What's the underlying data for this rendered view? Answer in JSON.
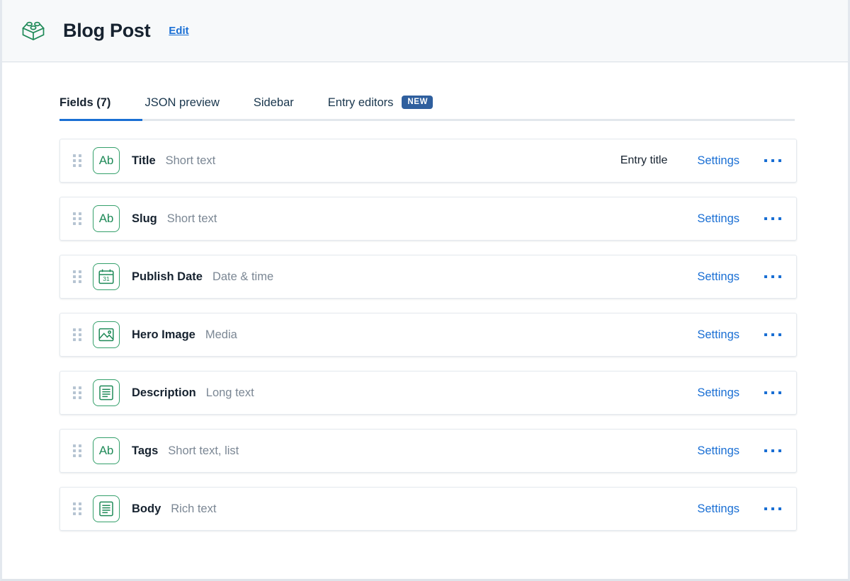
{
  "header": {
    "icon": "lego-brick-icon",
    "title": "Blog Post",
    "edit_label": "Edit",
    "accent_green": "#1f8a58",
    "link_blue": "#1a6fd4"
  },
  "tabs": [
    {
      "label": "Fields (7)",
      "active": true,
      "badge": null
    },
    {
      "label": "JSON preview",
      "active": false,
      "badge": null
    },
    {
      "label": "Sidebar",
      "active": false,
      "badge": null
    },
    {
      "label": "Entry editors",
      "active": false,
      "badge": "NEW"
    }
  ],
  "fields": {
    "settings_label": "Settings",
    "more_label": "...",
    "items": [
      {
        "icon": "short-text-icon",
        "icon_glyph": "Ab",
        "name": "Title",
        "type": "Short text",
        "tag": "Entry title"
      },
      {
        "icon": "short-text-icon",
        "icon_glyph": "Ab",
        "name": "Slug",
        "type": "Short text",
        "tag": ""
      },
      {
        "icon": "calendar-icon",
        "icon_glyph": "31",
        "name": "Publish Date",
        "type": "Date & time",
        "tag": ""
      },
      {
        "icon": "media-image-icon",
        "icon_glyph": "",
        "name": "Hero Image",
        "type": "Media",
        "tag": ""
      },
      {
        "icon": "long-text-icon",
        "icon_glyph": "",
        "name": "Description",
        "type": "Long text",
        "tag": ""
      },
      {
        "icon": "short-text-icon",
        "icon_glyph": "Ab",
        "name": "Tags",
        "type": "Short text, list",
        "tag": ""
      },
      {
        "icon": "rich-text-icon",
        "icon_glyph": "",
        "name": "Body",
        "type": "Rich text",
        "tag": ""
      }
    ]
  }
}
